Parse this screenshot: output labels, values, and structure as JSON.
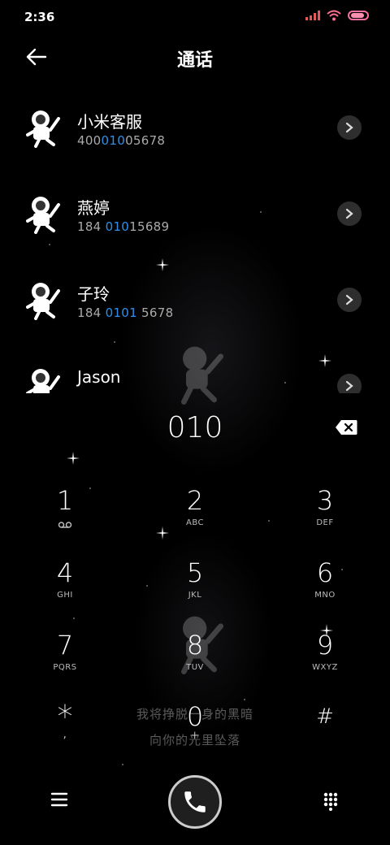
{
  "status_bar": {
    "time": "2:36"
  },
  "header": {
    "title": "通话"
  },
  "contacts": [
    {
      "name": "小米客服",
      "number_parts": [
        "400",
        "010",
        "05678"
      ]
    },
    {
      "name": "燕婷",
      "number_parts": [
        "184 ",
        "010",
        "15689"
      ]
    },
    {
      "name": "子玲",
      "number_parts": [
        "184 ",
        "0101",
        " 5678"
      ]
    },
    {
      "name": "Jason",
      "number_parts": [
        "",
        "",
        ""
      ]
    }
  ],
  "dialer": {
    "entered_number": "010",
    "keys": [
      {
        "digit": "1",
        "letters": ""
      },
      {
        "digit": "2",
        "letters": "ABC"
      },
      {
        "digit": "3",
        "letters": "DEF"
      },
      {
        "digit": "4",
        "letters": "GHI"
      },
      {
        "digit": "5",
        "letters": "JKL"
      },
      {
        "digit": "6",
        "letters": "MNO"
      },
      {
        "digit": "7",
        "letters": "PQRS"
      },
      {
        "digit": "8",
        "letters": "TUV"
      },
      {
        "digit": "9",
        "letters": "WXYZ"
      },
      {
        "digit": "*",
        "letters": ","
      },
      {
        "digit": "0",
        "letters": "+"
      },
      {
        "digit": "#",
        "letters": ""
      }
    ]
  },
  "wallpaper": {
    "lyric_line1": "我将挣脱一身的黑暗",
    "lyric_line2": "向你的光里坠落"
  },
  "icons": {
    "back": "arrow-left-icon",
    "chevron": "chevron-right-icon",
    "backspace": "backspace-icon",
    "voicemail": "voicemail-icon",
    "menu": "menu-icon",
    "call": "phone-icon",
    "keypad": "keypad-icon"
  },
  "colors": {
    "highlight": "#2f8fe8",
    "background": "#000000"
  }
}
